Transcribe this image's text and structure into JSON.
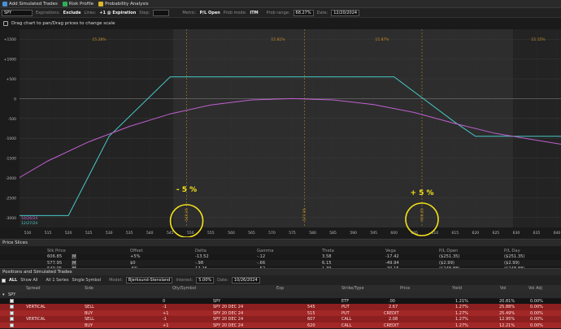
{
  "tabs": [
    {
      "label": "Add Simulated Trades",
      "icon": "plus-icon",
      "color": "#4a8fd8"
    },
    {
      "label": "Risk Profile",
      "icon": "chart-icon",
      "color": "#2fae5a"
    },
    {
      "label": "Probability Analysis",
      "icon": "probability-icon",
      "color": "#d9b72a"
    }
  ],
  "toolbar": {
    "symbol": "SPY",
    "expiration_label": "Expirations:",
    "expiration_value": "Exclude",
    "lines_label": "Lines:",
    "lines_value": "+1 @ Expiration",
    "step_label": "Step:",
    "step_value": "",
    "metric_label": "Metric:",
    "metric_value": "P/L Open",
    "prob_mode_label": "Prob mode:",
    "prob_mode_value": "ITM",
    "prob_range_label": "Prob range:",
    "prob_range_value": "68.27%",
    "date_label": "Date:",
    "date_value": "12/20/2024"
  },
  "hint": "Drag chart to pan/Drag prices to change scale",
  "chart_data": {
    "type": "line",
    "x_ticks": [
      "510",
      "515",
      "520",
      "525",
      "530",
      "535",
      "540",
      "545",
      "550",
      "555",
      "560",
      "565",
      "570",
      "575",
      "580",
      "585",
      "590",
      "595",
      "600",
      "605",
      "610",
      "615",
      "620",
      "625",
      "630",
      "635",
      "640"
    ],
    "y_ticks": [
      "+1500",
      "+1000",
      "+500",
      "0",
      "-500",
      "-1000",
      "-1500",
      "-2000",
      "-2500",
      "-3000"
    ],
    "xlim": [
      508,
      641
    ],
    "ylim": [
      -3250,
      1750
    ],
    "prob_labels": [
      "15.28%",
      "15.81%",
      "15.87%",
      "15.15%"
    ],
    "vline_labels": [
      "549.05",
      "577.95",
      "606.85"
    ],
    "date_labels": [
      "10/26/24",
      "12/27/24"
    ],
    "annotations": [
      "- 5 %",
      "+ 5 %"
    ],
    "series": [
      {
        "color": "#47c9c6",
        "x": [
          508,
          520,
          530,
          545,
          600,
          615,
          620,
          641
        ],
        "y": [
          -2950,
          -2950,
          -950,
          550,
          550,
          -600,
          -950,
          -950
        ]
      },
      {
        "color": "#c060d0",
        "x": [
          508,
          515,
          525,
          535,
          545,
          555,
          565,
          575,
          585,
          595,
          605,
          615,
          625,
          635,
          641
        ],
        "y": [
          -1990,
          -1570,
          -1090,
          -700,
          -385,
          -160,
          -32,
          0,
          -32,
          -150,
          -350,
          -630,
          -880,
          -1050,
          -1150
        ]
      }
    ]
  },
  "price_slices": {
    "title": "Price Slices",
    "headers": [
      "Stk Price",
      "Offset",
      "Delta",
      "Gamma",
      "Theta",
      "Vega",
      "P/L Open",
      "P/L Day"
    ],
    "rows": [
      [
        "606.85",
        "+5%",
        "-13.52",
        "-.12",
        "3.58",
        "-17.42",
        "($251.35)",
        "($251.35)"
      ],
      [
        "577.95",
        "$0",
        "-.98",
        "-.66",
        "6.15",
        "-49.94",
        "($2.99)",
        "($2.99)"
      ],
      [
        "549.05",
        "-5%",
        "17.26",
        "-.52",
        "1.39",
        "-30.15",
        "($248.88)",
        "($248.88)"
      ]
    ],
    "marker": "M"
  },
  "positions": {
    "title": "Positions and Simulated Trades",
    "toolbar": {
      "all": "ALL",
      "show_all": "Show All",
      "series": "All 1 Series",
      "single_symbol": "Single Symbol",
      "model_label": "Model:",
      "model_value": "Bjerksund-Stensland",
      "interest_label": "Interest:",
      "interest_value": "5.00%",
      "date_label": "Date:",
      "date_value": "10/26/2024"
    },
    "headers": [
      "Spread",
      "Side",
      "Qty/Symbol",
      "Exp",
      "Strike/Type",
      "Price",
      "Yield",
      "Vol",
      "Vol Adj"
    ],
    "group": "SPY",
    "rows": [
      {
        "style": "dark",
        "spread": "",
        "side": "",
        "qty": "0",
        "symbol": "SPY",
        "exp": "",
        "strike": "",
        "type": "ETF",
        "price": ".00",
        "price2": "",
        "yield": "1.21%",
        "vol": "20.81%",
        "voladj": "0.00%"
      },
      {
        "style": "red",
        "spread": "VERTICAL",
        "side": "SELL",
        "qty": "-1",
        "symbol": "SPY 20 DEC 24",
        "exp": "",
        "strike": "545",
        "type": "PUT",
        "price": "2.67",
        "price2": "",
        "yield": "1.27%",
        "vol": "25.88%",
        "voladj": "0.00%"
      },
      {
        "style": "red2",
        "spread": "",
        "side": "BUY",
        "qty": "+1",
        "symbol": "SPY 20 DEC 24",
        "exp": "",
        "strike": "515",
        "type": "PUT",
        "price": "",
        "price2": "CREDIT",
        "yield": "1.27%",
        "vol": "25.49%",
        "voladj": "0.00%"
      },
      {
        "style": "red",
        "spread": "VERTICAL",
        "side": "SELL",
        "qty": "-1",
        "symbol": "SPY 20 DEC 24",
        "exp": "",
        "strike": "607",
        "type": "CALL",
        "price": "2.08",
        "price2": "",
        "yield": "1.27%",
        "vol": "12.95%",
        "voladj": "0.00%"
      },
      {
        "style": "red2",
        "spread": "",
        "side": "BUY",
        "qty": "+1",
        "symbol": "SPY 20 DEC 24",
        "exp": "",
        "strike": "620",
        "type": "CALL",
        "price": "",
        "price2": "CREDIT",
        "yield": "1.27%",
        "vol": "12.21%",
        "voladj": "0.00%"
      }
    ]
  }
}
